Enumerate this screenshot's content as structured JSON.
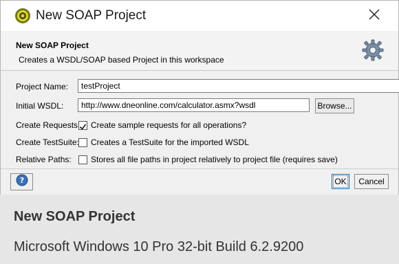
{
  "window": {
    "title": "New SOAP Project",
    "icon": "soapui-logo-icon",
    "close_icon": "close-icon"
  },
  "header": {
    "title": "New SOAP Project",
    "description": "Creates a WSDL/SOAP based Project in this workspace",
    "icon": "gear-icon"
  },
  "form": {
    "project_name": {
      "label": "Project Name:",
      "value": "testProject"
    },
    "initial_wsdl": {
      "label": "Initial WSDL:",
      "value": "http://www.dneonline.com/calculator.asmx?wsdl",
      "browse_label": "Browse..."
    },
    "create_requests": {
      "label": "Create Requests:",
      "checked": true,
      "text": "Create sample requests for all operations?"
    },
    "create_testsuite": {
      "label": "Create TestSuite:",
      "checked": false,
      "text": "Creates a TestSuite for the imported WSDL"
    },
    "relative_paths": {
      "label": "Relative Paths:",
      "checked": false,
      "text": "Stores all file paths in project relatively to project file (requires save)"
    }
  },
  "footer": {
    "help_icon": "help-icon",
    "ok_label": "OK",
    "cancel_label": "Cancel"
  },
  "caption": {
    "title": "New SOAP Project",
    "subtitle": "Microsoft Windows 10 Pro 32-bit Build 6.2.9200"
  },
  "colors": {
    "accent": "#1a6aa8",
    "dialog_bg": "#f0f0f0",
    "caption_bg": "#e6e6e6"
  }
}
